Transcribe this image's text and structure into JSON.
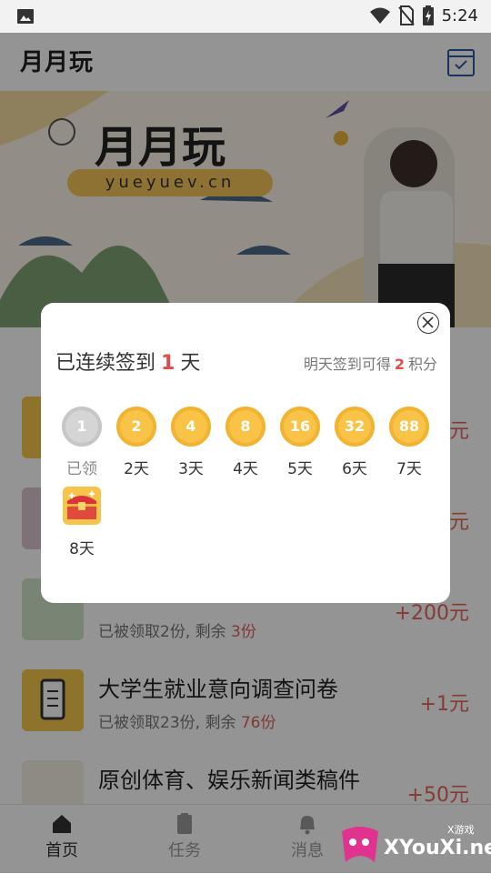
{
  "status_bar": {
    "time": "5:24",
    "icons": [
      "image-icon",
      "wifi-icon",
      "no-sim-icon",
      "battery-charging-icon"
    ]
  },
  "app_bar": {
    "title": "月月玩",
    "icon": "calendar-check-icon"
  },
  "banner": {
    "brand": "月月玩",
    "url": "yueyuev.cn"
  },
  "tasks": [
    {
      "title": "",
      "sub_prefix": "",
      "remain": "",
      "reward": "元"
    },
    {
      "title": "",
      "sub_prefix": "",
      "remain": "",
      "reward": "元"
    },
    {
      "title": "",
      "sub_prefix": "已被领取2份, 剩余 ",
      "remain": "3份",
      "reward": "+200元"
    },
    {
      "title": "大学生就业意向调查问卷",
      "sub_prefix": "已被领取23份, 剩余 ",
      "remain": "76份",
      "reward": "+1元"
    },
    {
      "title": "原创体育、娱乐新闻类稿件",
      "sub_prefix": "",
      "remain": "",
      "reward": "+50元"
    }
  ],
  "bottom_nav": [
    {
      "label": "首页",
      "icon": "home-icon",
      "active": true
    },
    {
      "label": "任务",
      "icon": "task-icon",
      "active": false
    },
    {
      "label": "消息",
      "icon": "bell-icon",
      "active": false
    }
  ],
  "watermark": {
    "text": "XYouXi.net",
    "small": "X游戏"
  },
  "dialog": {
    "streak_prefix": "已连续签到",
    "streak_days": "1",
    "streak_suffix": "天",
    "tomorrow_prefix": "明天签到可得",
    "tomorrow_points": "2",
    "tomorrow_suffix": "积分",
    "days": [
      {
        "value": "1",
        "label": "已领",
        "claimed": true
      },
      {
        "value": "2",
        "label": "2天",
        "claimed": false
      },
      {
        "value": "4",
        "label": "3天",
        "claimed": false
      },
      {
        "value": "8",
        "label": "4天",
        "claimed": false
      },
      {
        "value": "16",
        "label": "5天",
        "claimed": false
      },
      {
        "value": "32",
        "label": "6天",
        "claimed": false
      },
      {
        "value": "88",
        "label": "7天",
        "claimed": false
      },
      {
        "value": "",
        "label": "8天",
        "claimed": false,
        "icon": "treasure-chest-icon"
      }
    ]
  }
}
